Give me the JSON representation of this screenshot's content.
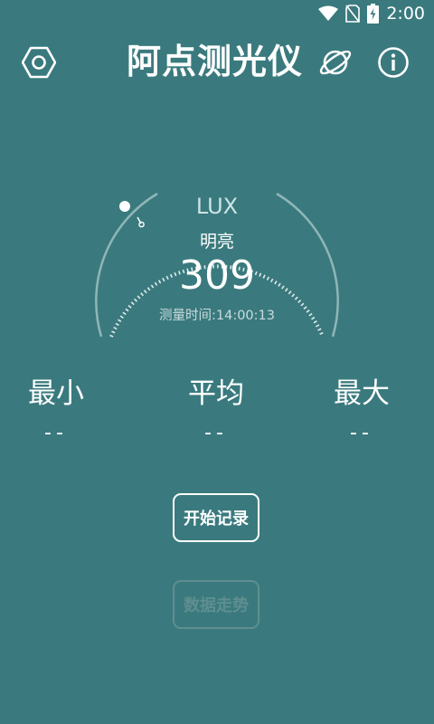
{
  "status": {
    "time": "2:00",
    "icons": [
      "wifi-icon",
      "no-sim-icon",
      "battery-charging-icon"
    ]
  },
  "header": {
    "title": "阿点测光仪",
    "left_icon": "settings-icon",
    "right_icons": [
      "planet-icon",
      "info-icon"
    ]
  },
  "gauge": {
    "unit": "LUX",
    "level": "明亮",
    "value": "309",
    "measure_time": "测量时间:14:00:13"
  },
  "stats": {
    "min": {
      "label": "最小",
      "value": "--"
    },
    "avg": {
      "label": "平均",
      "value": "--"
    },
    "max": {
      "label": "最大",
      "value": "--"
    }
  },
  "buttons": {
    "start_record": "开始记录",
    "data_trend": "数据走势"
  },
  "colors": {
    "background": "#3a7a7e",
    "disabled": "#5f8e90",
    "text": "#ffffff"
  }
}
